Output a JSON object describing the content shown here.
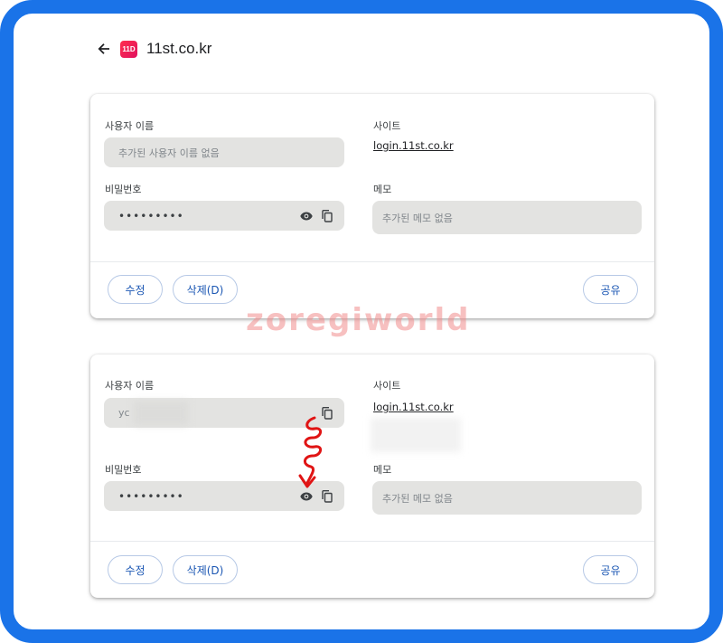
{
  "header": {
    "site_title": "11st.co.kr",
    "logo_text": "11D",
    "back_icon": "arrow-left-icon"
  },
  "cards": [
    {
      "username_label": "사용자 이름",
      "username_placeholder": "추가된 사용자 이름 없음",
      "password_label": "비밀번호",
      "password_masked": "•••••••••",
      "site_label": "사이트",
      "site_link": "login.11st.co.kr",
      "memo_label": "메모",
      "memo_placeholder": "추가된 메모 없음",
      "edit_label": "수정",
      "delete_label": "삭제(D)",
      "share_label": "공유"
    },
    {
      "username_label": "사용자 이름",
      "username_value": "yc",
      "password_label": "비밀번호",
      "password_masked": "•••••••••",
      "site_label": "사이트",
      "site_link": "login.11st.co.kr",
      "memo_label": "메모",
      "memo_placeholder": "추가된 메모 없음",
      "edit_label": "수정",
      "delete_label": "삭제(D)",
      "share_label": "공유"
    }
  ],
  "watermark": "zoregiworld",
  "colors": {
    "frame_border": "#1a73e8",
    "field_bg": "#e3e3e1",
    "pill_text": "#1a56b3",
    "annotation": "#e01414"
  }
}
